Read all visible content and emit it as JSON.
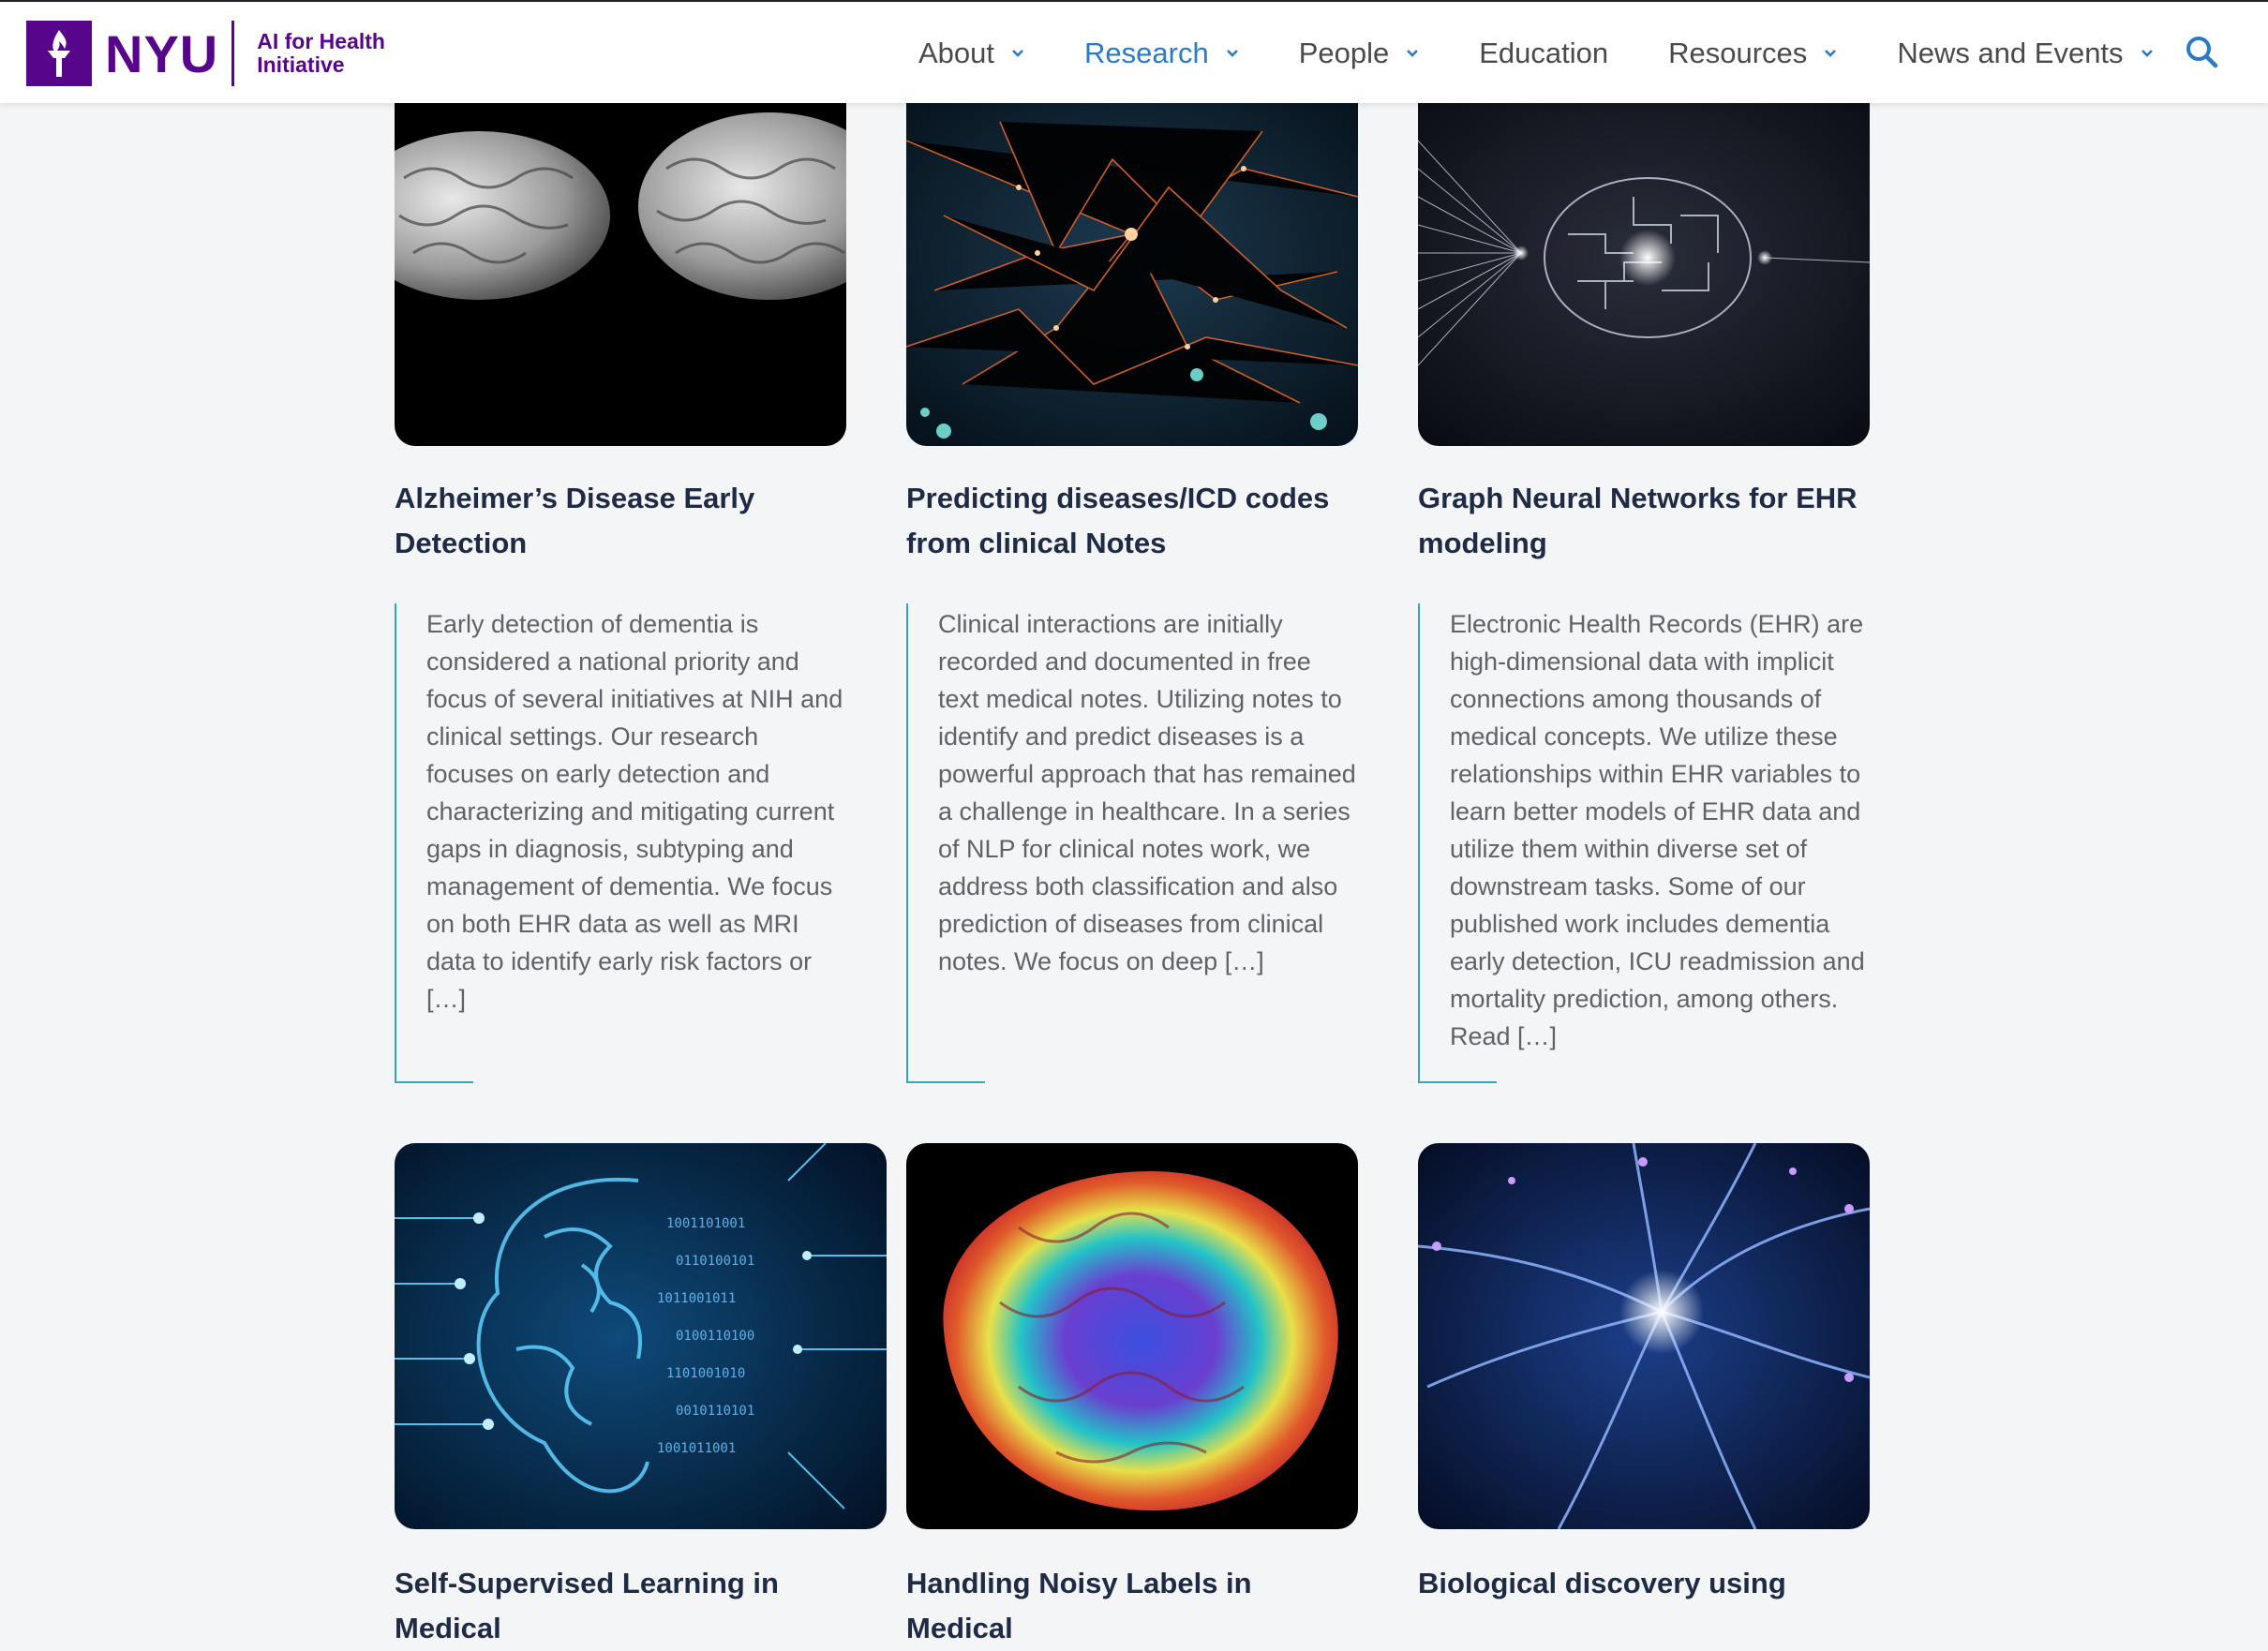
{
  "site": {
    "logo_wordmark": "NYU",
    "initiative_line1": "AI for Health",
    "initiative_line2": "Initiative",
    "brand_color": "#57068c",
    "accent_color": "#2a7ac9",
    "teal_color": "#33a8b5"
  },
  "nav": {
    "items": [
      {
        "label": "About",
        "has_dropdown": true,
        "active": false
      },
      {
        "label": "Research",
        "has_dropdown": true,
        "active": true
      },
      {
        "label": "People",
        "has_dropdown": true,
        "active": false
      },
      {
        "label": "Education",
        "has_dropdown": false,
        "active": false
      },
      {
        "label": "Resources",
        "has_dropdown": true,
        "active": false
      },
      {
        "label": "News and Events",
        "has_dropdown": true,
        "active": false
      }
    ],
    "search_icon": "search-icon"
  },
  "cards": [
    {
      "title_line1": "Alzheimer’s Disease Early",
      "title_line2": "Detection",
      "image_icon": "brain-photo",
      "description": "Early detection of dementia is considered a national priority and focus of several initiatives at NIH and clinical settings. Our research focuses on early detection and characterizing and mitigating current gaps in diagnosis, subtyping and management of dementia. We focus on both EHR data as well as MRI data to identify early risk factors or […]"
    },
    {
      "title_line1": "Predicting diseases/ICD codes",
      "title_line2": "from clinical Notes",
      "image_icon": "network-graphic",
      "description": "Clinical interactions are initially recorded and documented in free text medical notes. Utilizing notes to identify and predict diseases is a powerful approach that has remained a challenge in healthcare. In a series of NLP for clinical notes work, we address both classification and also prediction of diseases from clinical notes. We focus on deep […]"
    },
    {
      "title_line1": "Graph Neural Networks for EHR",
      "title_line2": "modeling",
      "image_icon": "circuit-brain-graphic",
      "description": "Electronic Health Records (EHR) are high-dimensional data with implicit connections among thousands of medical concepts. We utilize these relationships within EHR variables to learn better models of EHR data and utilize them within diverse set of downstream tasks. Some of our published work includes dementia early detection, ICU readmission and mortality prediction, among others. Read […]"
    },
    {
      "title_line1": "Self-Supervised Learning in Medical",
      "image_icon": "digital-brain-graphic"
    },
    {
      "title_line1": "Handling Noisy Labels in Medical",
      "image_icon": "brain-heatmap-graphic"
    },
    {
      "title_line1": "Biological discovery using",
      "image_icon": "data-neuron-graphic"
    }
  ]
}
